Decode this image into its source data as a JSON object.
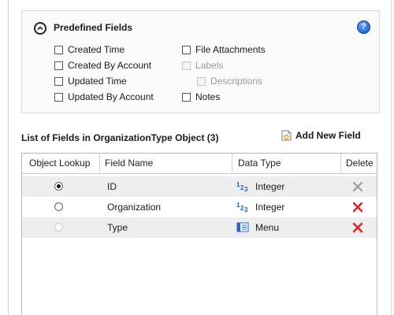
{
  "predefined": {
    "title": "Predefined Fields",
    "help_icon": "?",
    "checkboxes": {
      "created_time": "Created Time",
      "created_by_account": "Created By Account",
      "updated_time": "Updated Time",
      "updated_by_account": "Updated By Account",
      "file_attachments": "File Attachments",
      "labels": "Labels",
      "descriptions": "Descriptions",
      "notes": "Notes"
    }
  },
  "list": {
    "title": "List of Fields in OrganizationType Object (3)",
    "add_new_field": "Add New Field"
  },
  "table": {
    "columns": {
      "object_lookup": "Object Lookup",
      "field_name": "Field Name",
      "data_type": "Data Type",
      "delete": "Delete"
    },
    "rows": [
      {
        "field_name": "ID",
        "data_type": "Integer",
        "type_icon": "integer-icon",
        "lookup": "checked",
        "delete_enabled": false
      },
      {
        "field_name": "Organization",
        "data_type": "Integer",
        "type_icon": "integer-icon",
        "lookup": "unchecked",
        "delete_enabled": true
      },
      {
        "field_name": "Type",
        "data_type": "Menu",
        "type_icon": "menu-icon",
        "lookup": "disabled",
        "delete_enabled": true
      }
    ]
  },
  "colors": {
    "delete_active": "#e0201b",
    "delete_disabled": "#9c9c9c",
    "help_blue": "#1459c8"
  }
}
